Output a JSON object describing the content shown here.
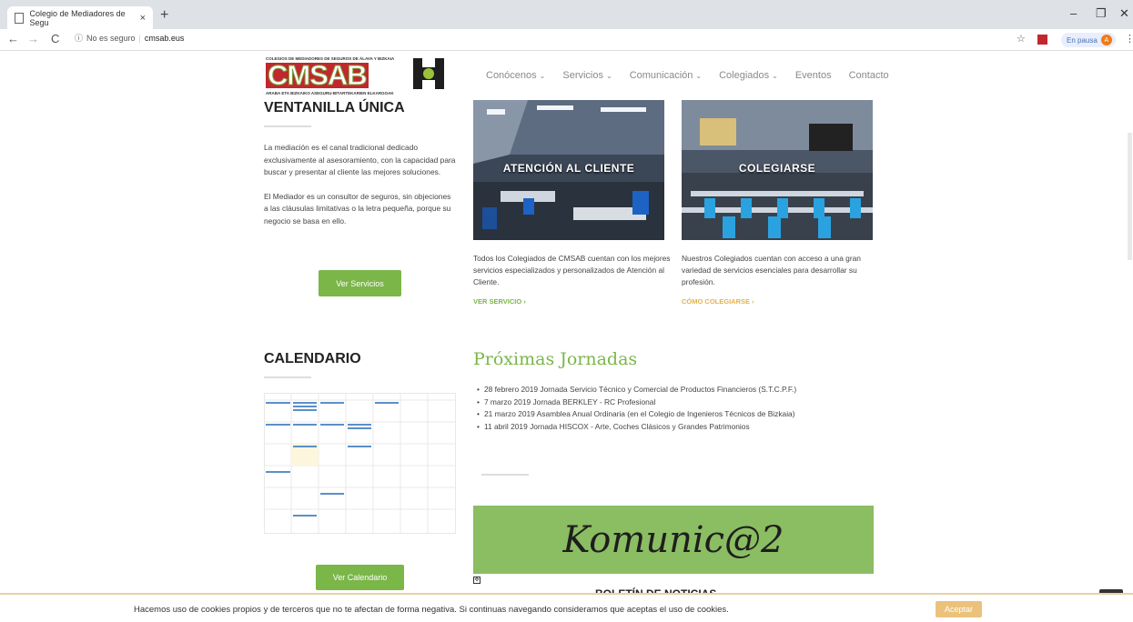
{
  "browser": {
    "tab_title": "Colegio de Mediadores de Segu",
    "tab_close": "×",
    "new_tab": "+",
    "security": "No es seguro",
    "url": "cmsab.eus",
    "pause_label": "En pausa",
    "avatar_letter": "A",
    "win_min": "–",
    "win_max": "❐",
    "win_close": "✕"
  },
  "logo": {
    "top_text": "COLEGIOS DE MEDIADORES DE SEGUROS DE ÁLAVA Y BIZKAIA",
    "main_text": "CMSAB",
    "bottom_text": "ARABA ETA BIZKAIKO ASEGURU-BITARTEKARIEN ELKARGOAK"
  },
  "nav": {
    "items": [
      {
        "label": "Conócenos",
        "chev": "⌄"
      },
      {
        "label": "Servicios",
        "chev": "⌄"
      },
      {
        "label": "Comunicación",
        "chev": "⌄"
      },
      {
        "label": "Colegiados",
        "chev": "⌄"
      },
      {
        "label": "Eventos",
        "chev": ""
      },
      {
        "label": "Contacto",
        "chev": ""
      }
    ]
  },
  "ventanilla": {
    "title": "VENTANILLA ÚNICA",
    "p1": "La mediación es el canal tradicional dedicado exclusivamente al asesoramiento, con la capacidad para buscar y presentar al cliente las mejores soluciones.",
    "p2": "El Mediador es un consultor de seguros, sin objeciones a las cláusulas limitativas o la letra pequeña, porque su negocio se basa en ello.",
    "button": "Ver Servicios"
  },
  "cards": [
    {
      "title": "ATENCIÓN AL CLIENTE",
      "text": "Todos los Colegiados de CMSAB cuentan con los mejores servicios especializados y personalizados de Atención al Cliente.",
      "link": "VER SERVICIO ›",
      "link_color": "#7ab648"
    },
    {
      "title": "COLEGIARSE",
      "text": "Nuestros Colegiados cuentan con acceso a una gran variedad de servicios esenciales para desarrollar su profesión.",
      "link": "CÓMO COLEGIARSE ›",
      "link_color": "#e3b24e"
    }
  ],
  "calendario": {
    "title": "CALENDARIO",
    "button": "Ver Calendario"
  },
  "jornadas": {
    "title": "Próximas Jornadas",
    "items": [
      "28 febrero 2019 Jornada Servicio Técnico y Comercial de Productos Financieros (S.T.C.P.F.)",
      "7 marzo 2019 Jornada BERKLEY - RC Profesional",
      "21 marzo 2019 Asamblea Anual Ordinaria (en el Colegio de Ingenieros Técnicos de Bizkaia)",
      "11 abril 2019 Jornada HISCOX - Arte, Coches Clásicos y Grandes Patrimonios"
    ]
  },
  "komunica": {
    "banner": "Komunic@2",
    "heading": "BOLETÍN DE NOTICIAS"
  },
  "cookie": {
    "text": "Hacemos uso de cookies propios y de terceros que no te afectan de forma negativa. Si continuas navegando consideramos que aceptas el uso de cookies.",
    "button": "Aceptar"
  },
  "colors": {
    "accent_green": "#7ab648",
    "accent_gold": "#ebc27c"
  }
}
